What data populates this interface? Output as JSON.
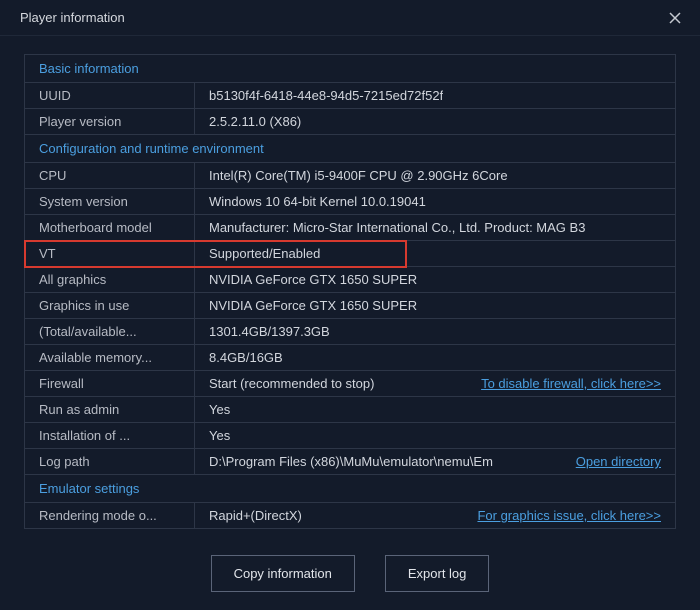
{
  "window": {
    "title": "Player information"
  },
  "sections": {
    "basic": {
      "header": "Basic information",
      "uuid_label": "UUID",
      "uuid_value": "b5130f4f-6418-44e8-94d5-7215ed72f52f",
      "version_label": "Player version",
      "version_value": "2.5.2.11.0 (X86)"
    },
    "config": {
      "header": "Configuration and runtime environment",
      "cpu_label": "CPU",
      "cpu_value": "Intel(R) Core(TM) i5-9400F CPU @ 2.90GHz 6Core",
      "sys_label": "System version",
      "sys_value": "Windows 10 64-bit Kernel 10.0.19041",
      "mb_label": "Motherboard model",
      "mb_value": "Manufacturer: Micro-Star International Co., Ltd.  Product: MAG B3",
      "vt_label": "VT",
      "vt_value": "Supported/Enabled",
      "allgfx_label": "All graphics",
      "allgfx_value": "NVIDIA GeForce GTX 1650 SUPER",
      "gfxuse_label": "Graphics in use",
      "gfxuse_value": "NVIDIA GeForce GTX 1650 SUPER",
      "disk_label": "(Total/available...",
      "disk_value": "1301.4GB/1397.3GB",
      "mem_label": "Available memory...",
      "mem_value": "8.4GB/16GB",
      "fw_label": "Firewall",
      "fw_value": "Start (recommended to stop)",
      "fw_link": "To disable firewall, click here>>",
      "admin_label": "Run as admin",
      "admin_value": "Yes",
      "install_label": "Installation of ...",
      "install_value": "Yes",
      "log_label": "Log path",
      "log_value": "D:\\Program Files (x86)\\MuMu\\emulator\\nemu\\Em",
      "log_link": "Open directory"
    },
    "emulator": {
      "header": "Emulator settings",
      "render_label": "Rendering mode o...",
      "render_value": "Rapid+(DirectX)",
      "render_link": "For graphics issue, click here>>"
    }
  },
  "buttons": {
    "copy": "Copy information",
    "export": "Export log"
  }
}
